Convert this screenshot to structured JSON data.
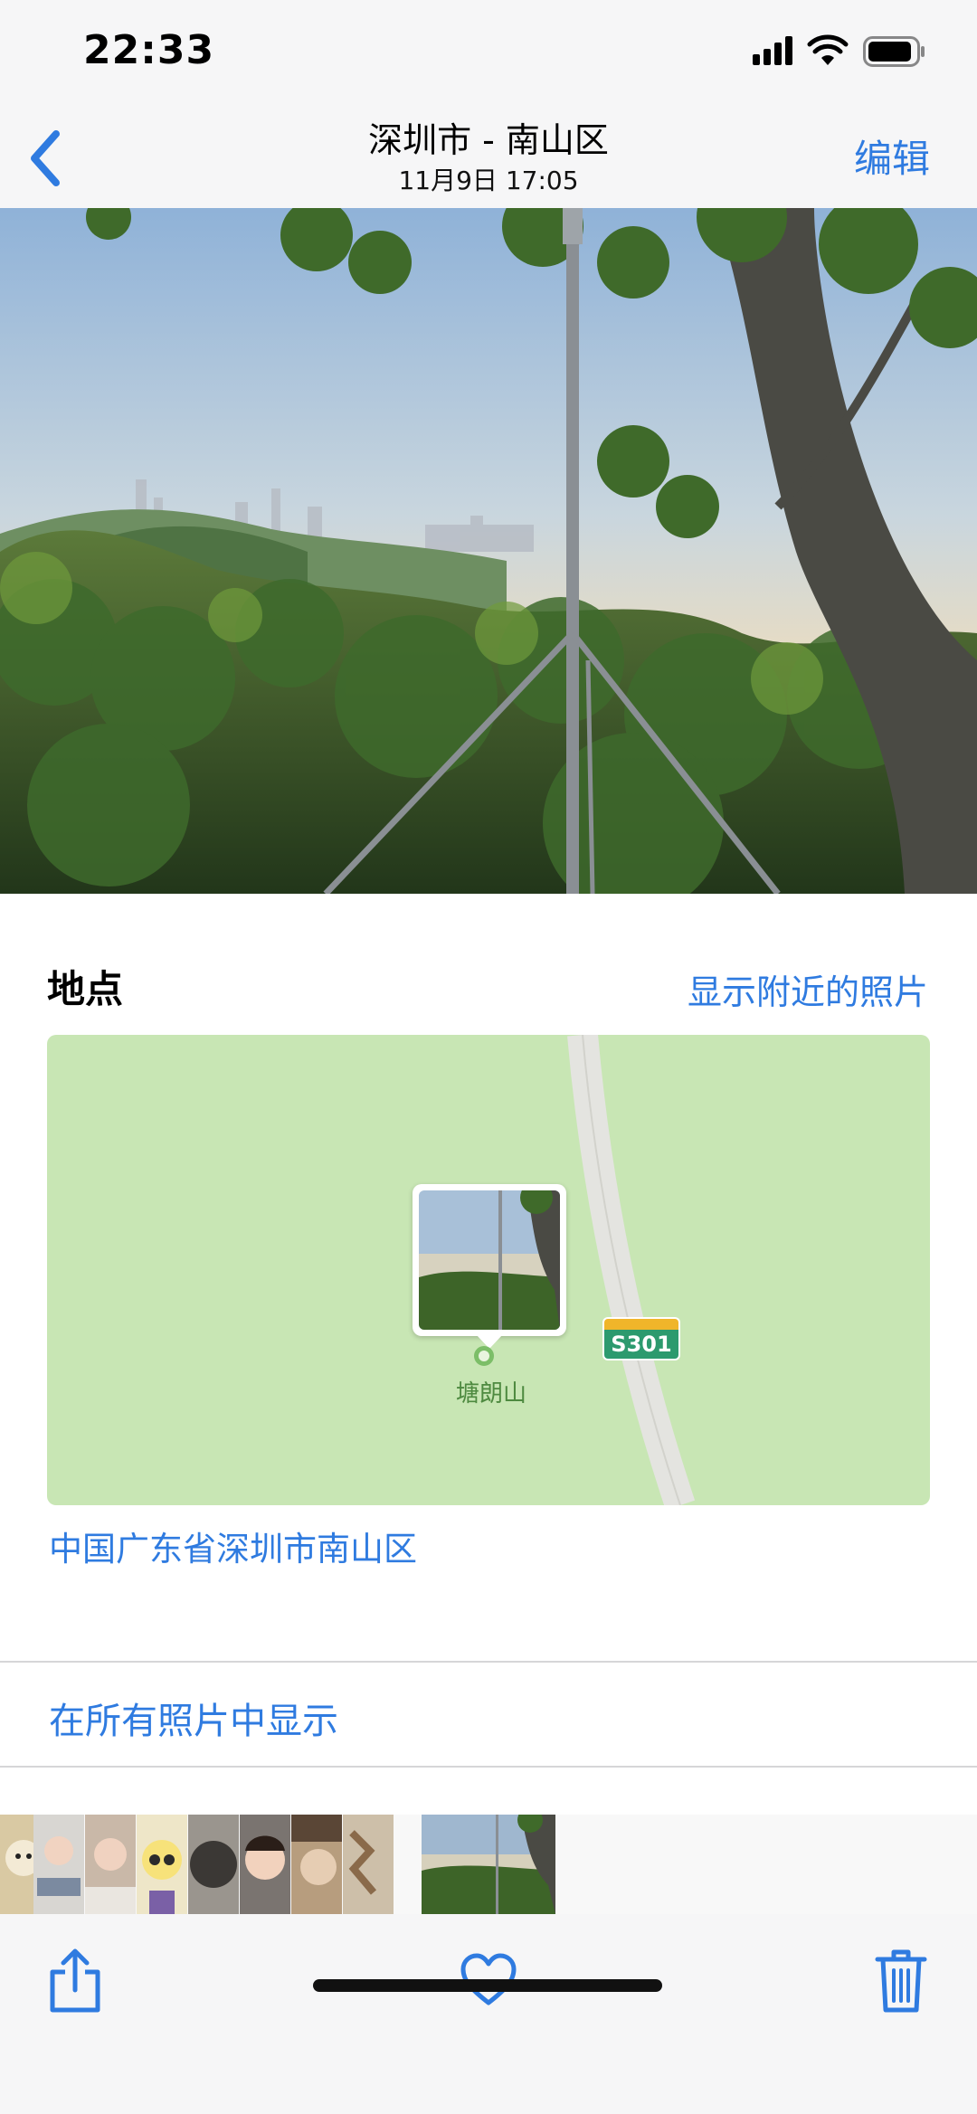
{
  "status_bar": {
    "time": "22:33",
    "icons": [
      "cellular-signal-icon",
      "wifi-icon",
      "battery-icon"
    ]
  },
  "nav": {
    "back_icon": "chevron-left-icon",
    "title": "深圳市 - 南山区",
    "subtitle": "11月9日  17:05",
    "edit_label": "编辑"
  },
  "photo": {
    "description_icon": "landscape-photo"
  },
  "location": {
    "section_title": "地点",
    "nearby_link": "显示附近的照片",
    "map": {
      "place_label": "塘朗山",
      "road_shield": "S301"
    },
    "address": "中国广东省深圳市南山区"
  },
  "show_all_link": "在所有照片中显示",
  "toolbar": {
    "share_icon": "share-icon",
    "like_icon": "heart-icon",
    "delete_icon": "trash-icon"
  },
  "colors": {
    "accent": "#2f7be0",
    "map_bg": "#c8e6b4",
    "bar_bg": "#f6f6f7"
  }
}
